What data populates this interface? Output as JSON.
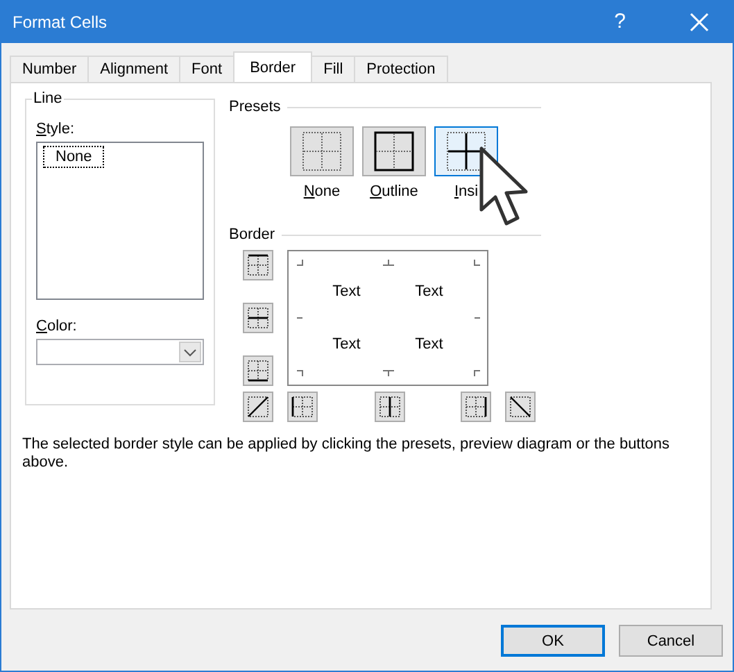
{
  "window": {
    "title": "Format Cells",
    "help": "?"
  },
  "tabs": [
    {
      "label": "Number",
      "selected": false
    },
    {
      "label": "Alignment",
      "selected": false
    },
    {
      "label": "Font",
      "selected": false
    },
    {
      "label": "Border",
      "selected": true
    },
    {
      "label": "Fill",
      "selected": false
    },
    {
      "label": "Protection",
      "selected": false
    }
  ],
  "line": {
    "title": "Line",
    "style_label": "Style:",
    "styles": [
      {
        "label": "None",
        "selected": true
      }
    ],
    "color_label": "Color:"
  },
  "presets": {
    "title": "Presets",
    "items": [
      {
        "kind": "none",
        "label": "None",
        "selected": false
      },
      {
        "kind": "outline",
        "label": "Outline",
        "selected": false
      },
      {
        "kind": "inside",
        "label": "Insi",
        "selected": true
      }
    ]
  },
  "border": {
    "title": "Border",
    "preview_texts": [
      "Text",
      "Text",
      "Text",
      "Text"
    ]
  },
  "description": "The selected border style can be applied by clicking the presets, preview diagram or the buttons above.",
  "buttons": [
    {
      "label": "OK",
      "default": true
    },
    {
      "label": "Cancel",
      "default": false
    }
  ]
}
